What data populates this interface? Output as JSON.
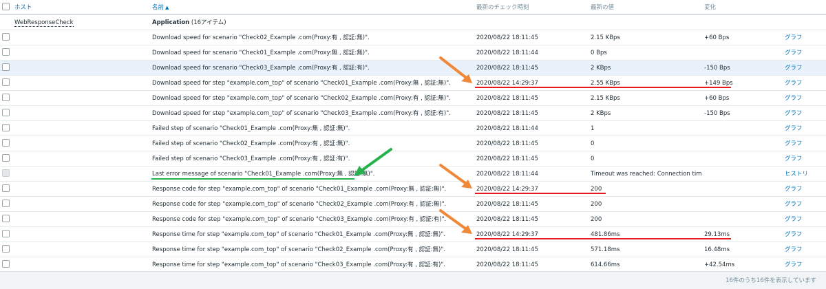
{
  "header": {
    "host": "ホスト",
    "name": "名前",
    "sort_indicator": "▲",
    "last_check": "最新のチェック時刻",
    "last_value": "最新の値",
    "change": "変化"
  },
  "group": {
    "host": "WebResponseCheck",
    "title": "Application",
    "count": "(16アイテム)"
  },
  "items": [
    {
      "name": "Download speed for scenario \"Check02_Example .com(Proxy:有 , 認証:無)\".",
      "time": "2020/08/22 18:11:45",
      "value": "2.15 KBps",
      "change": "+60 Bps",
      "action": "グラフ"
    },
    {
      "name": "Download speed for scenario \"Check01_Example .com(Proxy:無 , 認証:無)\".",
      "time": "2020/08/22 18:11:44",
      "value": "0 Bps",
      "change": "",
      "action": "グラフ"
    },
    {
      "name": "Download speed for scenario \"Check03_Example .com(Proxy:有 , 認証:有)\".",
      "time": "2020/08/22 18:11:45",
      "value": "2 KBps",
      "change": "-150 Bps",
      "action": "グラフ"
    },
    {
      "name": "Download speed for step \"example.com_top\" of scenario \"Check01_Example .com(Proxy:無 , 認証:無)\".",
      "time": "2020/08/22 14:29:37",
      "value": "2.55 KBps",
      "change": "+149 Bps",
      "action": "グラフ"
    },
    {
      "name": "Download speed for step \"example.com_top\" of scenario \"Check02_Example .com(Proxy:有 , 認証:無)\".",
      "time": "2020/08/22 18:11:45",
      "value": "2.15 KBps",
      "change": "+60 Bps",
      "action": "グラフ"
    },
    {
      "name": "Download speed for step \"example.com_top\" of scenario \"Check03_Example .com(Proxy:有 , 認証:有)\".",
      "time": "2020/08/22 18:11:45",
      "value": "2 KBps",
      "change": "-150 Bps",
      "action": "グラフ"
    },
    {
      "name": "Failed step of scenario \"Check01_Example .com(Proxy:無 , 認証:無)\".",
      "time": "2020/08/22 18:11:44",
      "value": "1",
      "change": "",
      "action": "グラフ"
    },
    {
      "name": "Failed step of scenario \"Check02_Example .com(Proxy:有 , 認証:無)\".",
      "time": "2020/08/22 18:11:45",
      "value": "0",
      "change": "",
      "action": "グラフ"
    },
    {
      "name": "Failed step of scenario \"Check03_Example .com(Proxy:有 , 認証:有)\".",
      "time": "2020/08/22 18:11:45",
      "value": "0",
      "change": "",
      "action": "グラフ"
    },
    {
      "name": "Last error message of scenario \"Check01_Example .com(Proxy:無 , 認証:無)\".",
      "time": "2020/08/22 18:11:44",
      "value": "Timeout was reached: Connection time...",
      "change": "",
      "action": "ヒストリ"
    },
    {
      "name": "Response code for step \"example.com_top\" of scenario \"Check01_Example .com(Proxy:無 , 認証:無)\".",
      "time": "2020/08/22 14:29:37",
      "value": "200",
      "change": "",
      "action": "グラフ"
    },
    {
      "name": "Response code for step \"example.com_top\" of scenario \"Check02_Example .com(Proxy:有 , 認証:無)\".",
      "time": "2020/08/22 18:11:45",
      "value": "200",
      "change": "",
      "action": "グラフ"
    },
    {
      "name": "Response code for step \"example.com_top\" of scenario \"Check03_Example .com(Proxy:有 , 認証:有)\".",
      "time": "2020/08/22 18:11:45",
      "value": "200",
      "change": "",
      "action": "グラフ"
    },
    {
      "name": "Response time for step \"example.com_top\" of scenario \"Check01_Example .com(Proxy:無 , 認証:無)\".",
      "time": "2020/08/22 14:29:37",
      "value": "481.86ms",
      "change": "29.13ms",
      "action": "グラフ"
    },
    {
      "name": "Response time for step \"example.com_top\" of scenario \"Check02_Example .com(Proxy:有 , 認証:無)\".",
      "time": "2020/08/22 18:11:45",
      "value": "571.18ms",
      "change": "16.48ms",
      "action": "グラフ"
    },
    {
      "name": "Response time for step \"example.com_top\" of scenario \"Check03_Example .com(Proxy:有 , 認証:有)\".",
      "time": "2020/08/22 18:11:45",
      "value": "614.66ms",
      "change": "+42.54ms",
      "action": "グラフ"
    }
  ],
  "footer": {
    "summary": "16件のうち16件を表示しています"
  },
  "colors": {
    "link": "#0275b8",
    "annotation_red": "#e8191c",
    "annotation_orange": "#f0883a",
    "annotation_green": "#25b14b",
    "hover_row": "#e9f2fb"
  }
}
